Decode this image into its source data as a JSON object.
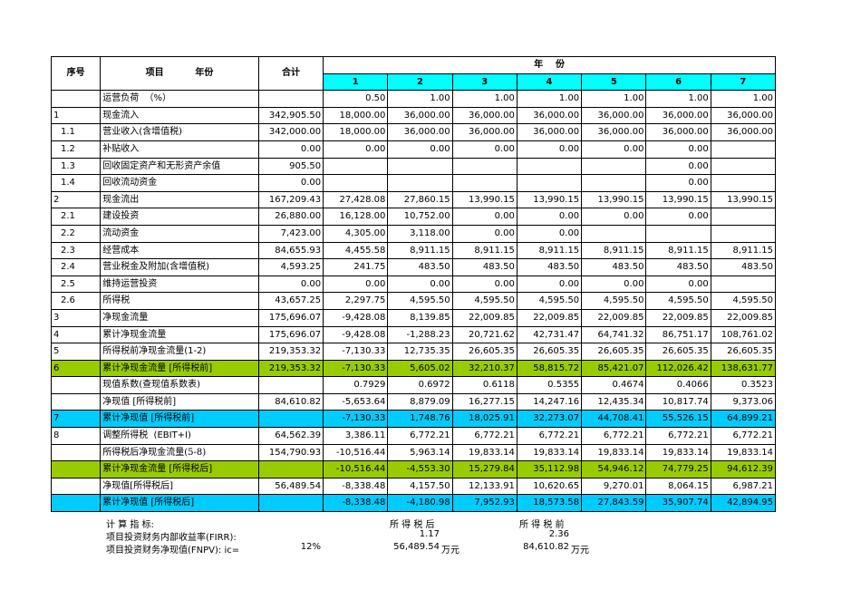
{
  "header": {
    "seq": "序号",
    "item_year": "项目          年份",
    "total": "合计",
    "year_group": "年    份",
    "years": [
      "1",
      "2",
      "3",
      "4",
      "5",
      "6",
      "7"
    ]
  },
  "rows": [
    {
      "seq": "",
      "item": "运营负荷  （%）",
      "indent": false,
      "serif": false,
      "style": "",
      "tag": "",
      "total": "",
      "values": [
        "0.50",
        "1.00",
        "1.00",
        "1.00",
        "1.00",
        "1.00",
        "1.00"
      ]
    },
    {
      "seq": "1",
      "item": "现金流入",
      "indent": false,
      "serif": false,
      "style": "",
      "tag": "",
      "total": "342,905.50",
      "values": [
        "18,000.00",
        "36,000.00",
        "36,000.00",
        "36,000.00",
        "36,000.00",
        "36,000.00",
        "36,000.00"
      ]
    },
    {
      "seq": "1.1",
      "item": "营业收入(含增值税)",
      "indent": true,
      "serif": false,
      "style": "",
      "tag": "",
      "total": "342,000.00",
      "values": [
        "18,000.00",
        "36,000.00",
        "36,000.00",
        "36,000.00",
        "36,000.00",
        "36,000.00",
        "36,000.00"
      ]
    },
    {
      "seq": "1.2",
      "item": "补贴收入",
      "indent": true,
      "serif": false,
      "style": "",
      "tag": "",
      "total": "0.00",
      "values": [
        "0.00",
        "0.00",
        "0.00",
        "0.00",
        "0.00",
        "0.00",
        ""
      ]
    },
    {
      "seq": "1.3",
      "item": "回收固定资产和无形资产余值",
      "indent": true,
      "serif": false,
      "style": "",
      "tag": "",
      "total": "905.50",
      "values": [
        "",
        "",
        "",
        "",
        "",
        "0.00",
        ""
      ]
    },
    {
      "seq": "1.4",
      "item": "回收流动资金",
      "indent": true,
      "serif": false,
      "style": "",
      "tag": "",
      "total": "0.00",
      "values": [
        "",
        "",
        "",
        "",
        "",
        "0.00",
        ""
      ]
    },
    {
      "seq": "2",
      "item": "现金流出",
      "indent": false,
      "serif": false,
      "style": "",
      "tag": "",
      "total": "167,209.43",
      "values": [
        "27,428.08",
        "27,860.15",
        "13,990.15",
        "13,990.15",
        "13,990.15",
        "13,990.15",
        "13,990.15"
      ]
    },
    {
      "seq": "2.1",
      "item": "建设投资",
      "indent": true,
      "serif": false,
      "style": "",
      "tag": "",
      "total": "26,880.00",
      "values": [
        "16,128.00",
        "10,752.00",
        "0.00",
        "0.00",
        "0.00",
        "0.00",
        ""
      ]
    },
    {
      "seq": "2.2",
      "item": "流动资金",
      "indent": true,
      "serif": false,
      "style": "",
      "tag": "",
      "total": "7,423.00",
      "values": [
        "4,305.00",
        "3,118.00",
        "0.00",
        "0.00",
        "",
        "",
        ""
      ]
    },
    {
      "seq": "2.3",
      "item": "经营成本",
      "indent": true,
      "serif": false,
      "style": "",
      "tag": "",
      "total": "84,655.93",
      "values": [
        "4,455.58",
        "8,911.15",
        "8,911.15",
        "8,911.15",
        "8,911.15",
        "8,911.15",
        "8,911.15"
      ]
    },
    {
      "seq": "2.4",
      "item": "营业税金及附加(含增值税)",
      "indent": true,
      "serif": false,
      "style": "",
      "tag": "",
      "total": "4,593.25",
      "values": [
        "241.75",
        "483.50",
        "483.50",
        "483.50",
        "483.50",
        "483.50",
        "483.50"
      ]
    },
    {
      "seq": "2.5",
      "item": "维持运营投资",
      "indent": true,
      "serif": false,
      "style": "",
      "tag": "",
      "total": "0.00",
      "values": [
        "0.00",
        "0.00",
        "0.00",
        "0.00",
        "0.00",
        "0.00",
        ""
      ]
    },
    {
      "seq": "2.6",
      "item": "所得税",
      "indent": true,
      "serif": true,
      "style": "",
      "tag": "",
      "total": "43,657.25",
      "values": [
        "2,297.75",
        "4,595.50",
        "4,595.50",
        "4,595.50",
        "4,595.50",
        "4,595.50",
        "4,595.50"
      ]
    },
    {
      "seq": "3",
      "item": "净现金流量",
      "indent": false,
      "serif": true,
      "style": "",
      "tag": "",
      "total": "175,696.07",
      "values": [
        "-9,428.08",
        "8,139.85",
        "22,009.85",
        "22,009.85",
        "22,009.85",
        "22,009.85",
        "22,009.85"
      ]
    },
    {
      "seq": "4",
      "item": "累计净现金流量",
      "indent": false,
      "serif": true,
      "style": "",
      "tag": "",
      "total": "175,696.07",
      "values": [
        "-9,428.08",
        "-1,288.23",
        "20,721.62",
        "42,731.47",
        "64,741.32",
        "86,751.17",
        "108,761.02"
      ]
    },
    {
      "seq": "5",
      "item": "所得税前净现金流量(1-2)",
      "indent": false,
      "serif": false,
      "style": "",
      "tag": "",
      "total": "219,353.32",
      "values": [
        "-7,130.33",
        "12,735.35",
        "26,605.35",
        "26,605.35",
        "26,605.35",
        "26,605.35",
        "26,605.35"
      ]
    },
    {
      "seq": "6",
      "item": "累计净现金流量 ",
      "indent": false,
      "serif": true,
      "style": "green",
      "tag": "[所得税前]",
      "total": "219,353.32",
      "values": [
        "-7,130.33",
        "5,605.02",
        "32,210.37",
        "58,815.72",
        "85,421.07",
        "112,026.42",
        "138,631.77"
      ]
    },
    {
      "seq": "",
      "item": "现值系数(查现值系数表)",
      "indent": false,
      "serif": false,
      "style": "",
      "tag": "",
      "total": "",
      "values": [
        "0.7929",
        "0.6972",
        "0.6118",
        "0.5355",
        "0.4674",
        "0.4066",
        "0.3523"
      ]
    },
    {
      "seq": "",
      "item": "净现值 [所得税前]",
      "indent": false,
      "serif": true,
      "style": "",
      "tag": "",
      "total": "84,610.82",
      "values": [
        "-5,653.64",
        "8,879.09",
        "16,277.15",
        "14,247.16",
        "12,435.34",
        "10,817.74",
        "9,373.06"
      ]
    },
    {
      "seq": "7",
      "item": "累计净现值 [所得税前]",
      "indent": false,
      "serif": true,
      "style": "cyan",
      "tag": "",
      "total": "",
      "values": [
        "-7,130.33",
        "1,748.76",
        "18,025.91",
        "32,273.07",
        "44,708.41",
        "55,526.15",
        "64,899.21"
      ]
    },
    {
      "seq": "8",
      "item": "调整所得税  (EBIT+I)",
      "indent": false,
      "serif": false,
      "style": "",
      "tag": "",
      "total": "64,562.39",
      "values": [
        "3,386.11",
        "6,772.21",
        "6,772.21",
        "6,772.21",
        "6,772.21",
        "6,772.21",
        "6,772.21"
      ]
    },
    {
      "seq": "",
      "item": "所得税后净现金流量(5-8)",
      "indent": false,
      "serif": true,
      "style": "",
      "tag": "",
      "total": "154,790.93",
      "values": [
        "-10,516.44",
        "5,963.14",
        "19,833.14",
        "19,833.14",
        "19,833.14",
        "19,833.14",
        "19,833.14"
      ]
    },
    {
      "seq": "",
      "item": "累计净现金流量 ",
      "indent": false,
      "serif": true,
      "style": "green",
      "tag": "[所得税后]",
      "total": "",
      "values": [
        "-10,516.44",
        "-4,553.30",
        "15,279.84",
        "35,112.98",
        "54,946.12",
        "74,779.25",
        "94,612.39"
      ]
    },
    {
      "seq": "",
      "item": "净现值[所得税后]",
      "indent": false,
      "serif": false,
      "style": "",
      "tag": "",
      "total": "56,489.54",
      "values": [
        "-8,338.48",
        "4,157.50",
        "12,133.91",
        "10,620.65",
        "9,270.01",
        "8,064.15",
        "6,987.21"
      ]
    },
    {
      "seq": "",
      "item": "累计净现值 [所得税后]",
      "indent": false,
      "serif": true,
      "style": "cyan",
      "tag": "",
      "total": "",
      "values": [
        "-8,338.48",
        "-4,180.98",
        "7,952.93",
        "18,573.58",
        "27,843.59",
        "35,907.74",
        "42,894.95"
      ]
    }
  ],
  "indicators": {
    "title": "计 算 指 标:",
    "after_tax_label": "所 得 税 后",
    "before_tax_label": "所 得 税 前",
    "firr_label": "项目投资财务内部收益率(FIRR):",
    "firr_after": "1.17",
    "firr_before": "2.36",
    "fnpv_label": "项目投资财务净现值(FNPV):  ic=",
    "ic": "12%",
    "fnpv_after": "56,489.54",
    "fnpv_before": "84,610.82",
    "unit": "万元"
  },
  "colors": {
    "year_header": "#00ffff",
    "green_band": "#99cc00",
    "cyan_band": "#00ccff",
    "tag_text": "#e26b0a"
  }
}
